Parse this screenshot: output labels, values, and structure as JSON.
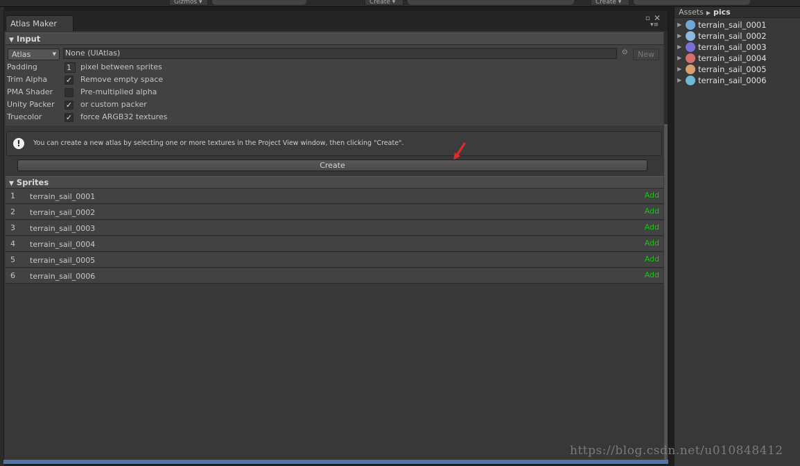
{
  "background": {
    "toolbar_labels": [
      "Gizmos ▾",
      "Create ▾",
      "Create ▾"
    ]
  },
  "window": {
    "tab_title": "Atlas Maker",
    "input_header": "Input",
    "atlas_dropdown": "Atlas",
    "atlas_value": "None (UIAtlas)",
    "new_label": "New",
    "properties": [
      {
        "label": "Padding",
        "kind": "number",
        "value": "1",
        "desc": "pixel between sprites"
      },
      {
        "label": "Trim Alpha",
        "kind": "checkbox",
        "checked": true,
        "desc": "Remove empty space"
      },
      {
        "label": "PMA Shader",
        "kind": "checkbox",
        "checked": false,
        "desc": "Pre-multiplied alpha"
      },
      {
        "label": "Unity Packer",
        "kind": "checkbox",
        "checked": true,
        "desc": "or custom packer"
      },
      {
        "label": "Truecolor",
        "kind": "checkbox",
        "checked": true,
        "desc": "force ARGB32 textures"
      }
    ],
    "info_text": "You can create a new atlas by selecting one or more textures in the Project View window, then clicking \"Create\".",
    "create_label": "Create",
    "sprites_header": "Sprites",
    "sprites": [
      {
        "index": "1",
        "name": "terrain_sail_0001",
        "action": "Add"
      },
      {
        "index": "2",
        "name": "terrain_sail_0002",
        "action": "Add"
      },
      {
        "index": "3",
        "name": "terrain_sail_0003",
        "action": "Add"
      },
      {
        "index": "4",
        "name": "terrain_sail_0004",
        "action": "Add"
      },
      {
        "index": "5",
        "name": "terrain_sail_0005",
        "action": "Add"
      },
      {
        "index": "6",
        "name": "terrain_sail_0006",
        "action": "Add"
      }
    ]
  },
  "project": {
    "breadcrumb_root": "Assets",
    "breadcrumb_folder": "pics",
    "items": [
      {
        "name": "terrain_sail_0001",
        "color": "#6fa8d8"
      },
      {
        "name": "terrain_sail_0002",
        "color": "#8fb8e0"
      },
      {
        "name": "terrain_sail_0003",
        "color": "#7a6fd8"
      },
      {
        "name": "terrain_sail_0004",
        "color": "#d86f6f"
      },
      {
        "name": "terrain_sail_0005",
        "color": "#d8a06f"
      },
      {
        "name": "terrain_sail_0006",
        "color": "#6fb8d8"
      }
    ]
  },
  "colors": {
    "add_green": "#1fbf1f",
    "arrow_red": "#e02a2a",
    "window_bottom": "#5573a3"
  },
  "watermark": "https://blog.csdn.net/u010848412"
}
